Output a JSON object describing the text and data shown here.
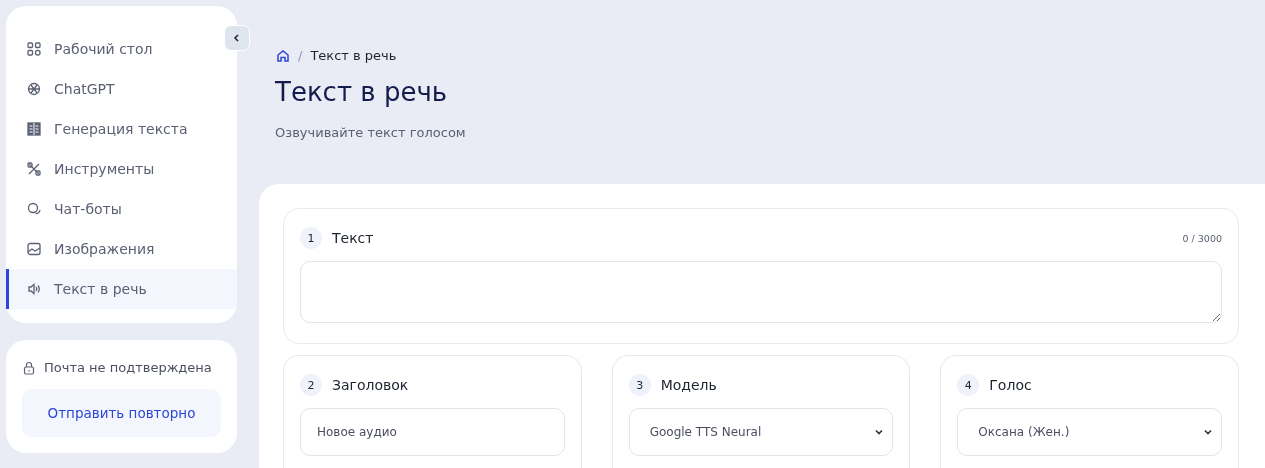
{
  "sidebar": {
    "items": [
      {
        "label": "Рабочий стол",
        "selected": false
      },
      {
        "label": "ChatGPT",
        "selected": false
      },
      {
        "label": "Генерация текста",
        "selected": false
      },
      {
        "label": "Инструменты",
        "selected": false
      },
      {
        "label": "Чат-боты",
        "selected": false
      },
      {
        "label": "Изображения",
        "selected": false
      },
      {
        "label": "Текст в речь",
        "selected": true
      }
    ]
  },
  "email_notice": {
    "text": "Почта не подтверждена",
    "button": "Отправить повторно"
  },
  "breadcrumb": {
    "separator": "/",
    "current": "Текст в речь"
  },
  "page": {
    "title": "Текст в речь",
    "subtitle": "Озвучивайте текст голосом"
  },
  "sections": [
    {
      "kind": "textarea",
      "number": "1",
      "label": "Текст",
      "counter": "0 / 3000"
    },
    {
      "kind": "input",
      "number": "2",
      "label": "Заголовок",
      "value": "Новое аудио"
    },
    {
      "kind": "select",
      "number": "3",
      "label": "Модель",
      "value": "Google TTS Neural"
    },
    {
      "kind": "select",
      "number": "4",
      "label": "Голос",
      "value": "Оксана (Жен.)"
    }
  ]
}
